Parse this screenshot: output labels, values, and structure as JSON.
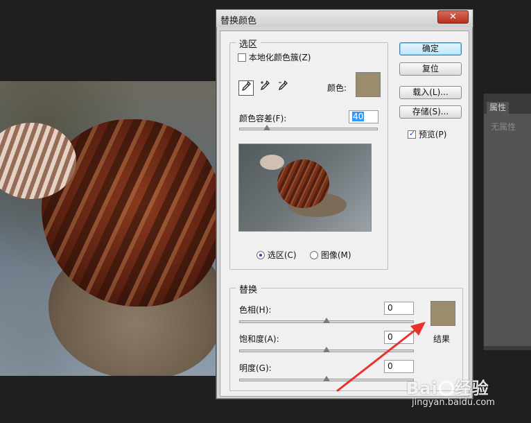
{
  "dialog": {
    "title": "替换颜色",
    "close_glyph": "✕",
    "selection_group": {
      "legend": "选区",
      "localized_clusters": {
        "label": "本地化颜色簇(Z)",
        "checked": false
      },
      "color_label": "颜色:",
      "color_swatch": "#9b8c6e",
      "tolerance_label": "颜色容差(F):",
      "tolerance_value": "40",
      "tolerance_fraction": 0.2,
      "view_mode": [
        {
          "label": "选区(C)",
          "selected": true
        },
        {
          "label": "图像(M)",
          "selected": false
        }
      ]
    },
    "replace_group": {
      "legend": "替换",
      "hue": {
        "label": "色相(H):",
        "value": "0"
      },
      "saturation": {
        "label": "饱和度(A):",
        "value": "0"
      },
      "lightness": {
        "label": "明度(G):",
        "value": "0"
      },
      "result_label": "结果",
      "result_swatch": "#9b8c6e"
    },
    "buttons": {
      "ok": "确定",
      "reset": "复位",
      "load": "载入(L)...",
      "save": "存储(S)..."
    },
    "preview": {
      "label": "预览(P)",
      "checked": true
    }
  },
  "properties_panel": {
    "tab": "属性",
    "empty_text": "无属性"
  },
  "watermark": {
    "logo": "Bai",
    "logo_suffix": "经验",
    "url": "jingyan.baidu.com"
  }
}
